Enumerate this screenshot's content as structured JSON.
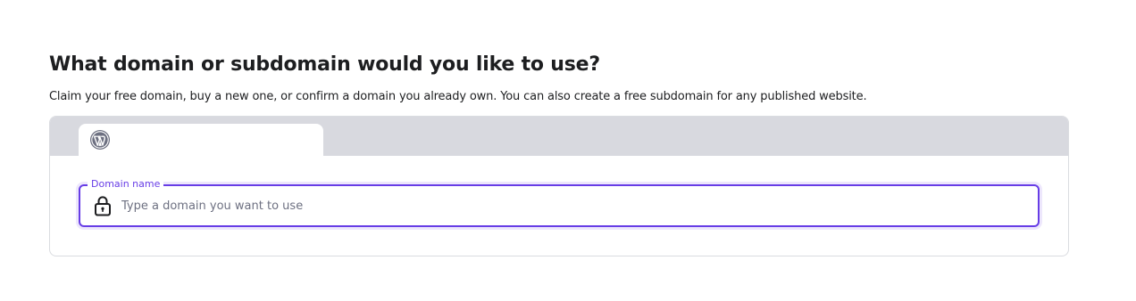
{
  "heading": "What domain or subdomain would you like to use?",
  "description": "Claim your free domain, buy a new one, or confirm a domain you already own. You can also create a free subdomain for any published website.",
  "tabs": [
    {
      "icon": "wordpress-icon",
      "label": ""
    }
  ],
  "domain_field": {
    "label": "Domain name",
    "value": "",
    "placeholder": "Type a domain you want to use",
    "icon": "lock-icon"
  },
  "colors": {
    "accent": "#673de6",
    "tab_bar": "#d8d9df",
    "text": "#1d1e20",
    "placeholder": "#6d7081",
    "border": "#dadce0"
  }
}
